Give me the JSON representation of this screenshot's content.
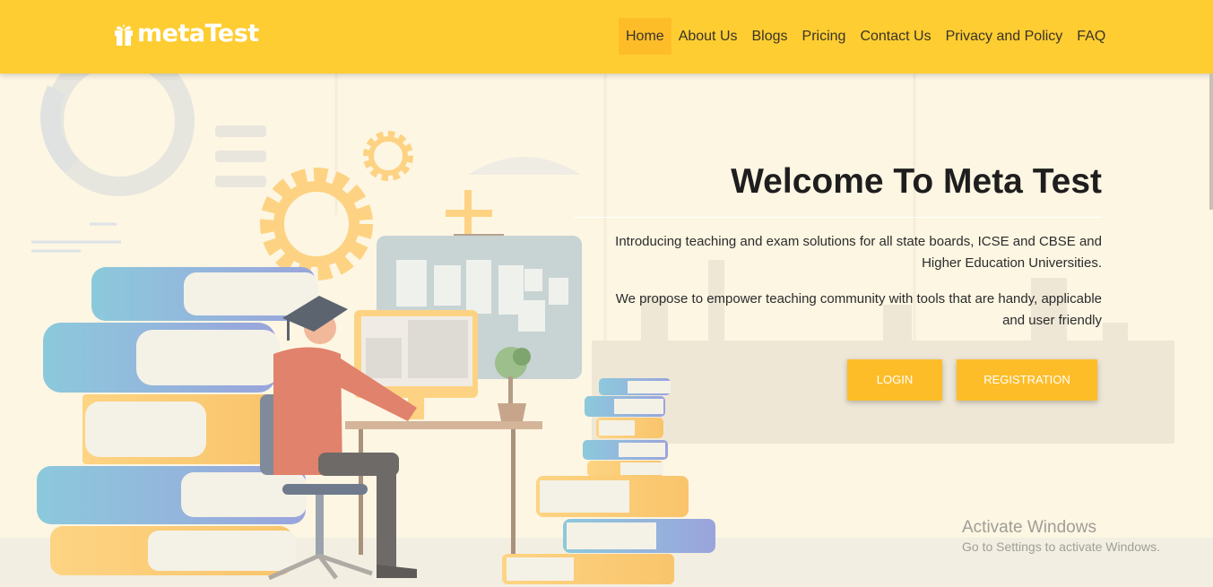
{
  "brand": {
    "name": "metaTest"
  },
  "nav": {
    "items": [
      {
        "label": "Home",
        "active": true
      },
      {
        "label": "About Us"
      },
      {
        "label": "Blogs"
      },
      {
        "label": "Pricing"
      },
      {
        "label": "Contact Us"
      },
      {
        "label": "Privacy and Policy"
      },
      {
        "label": "FAQ"
      }
    ]
  },
  "hero": {
    "title": "Welcome To Meta Test",
    "paragraph1": "Introducing teaching and exam solutions for all state boards, ICSE and CBSE and Higher Education Universities.",
    "paragraph2": "We propose to empower teaching community with tools that are handy, applicable and user friendly",
    "login_label": "LOGIN",
    "registration_label": "REGISTRATION"
  },
  "watermark": {
    "line1": "Activate Windows",
    "line2": "Go to Settings to activate Windows."
  },
  "colors": {
    "navbar": "#fecd32",
    "accent": "#fdbd29",
    "background": "#fdf6e3"
  },
  "icons": [
    "gift-logo-icon",
    "student-at-desk-illustration"
  ]
}
